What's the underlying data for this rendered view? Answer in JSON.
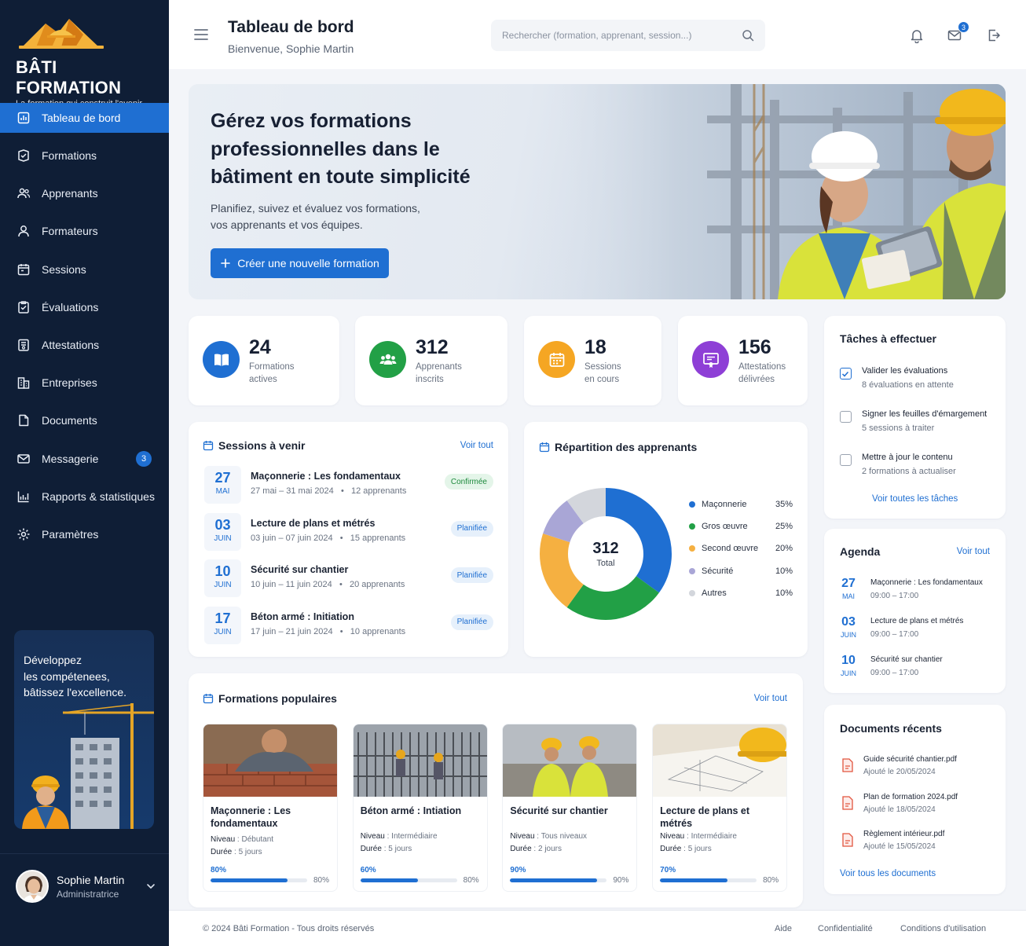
{
  "brand": {
    "name": "BÂTI FORMATION",
    "tagline": "La formation qui construit l'avenir"
  },
  "nav": [
    {
      "label": "Tableau de bord",
      "icon": "dashboard-icon",
      "active": true
    },
    {
      "label": "Formations",
      "icon": "book-check-icon"
    },
    {
      "label": "Apprenants",
      "icon": "users-icon"
    },
    {
      "label": "Formateurs",
      "icon": "user-icon"
    },
    {
      "label": "Sessions",
      "icon": "calendar-icon"
    },
    {
      "label": "Évaluations",
      "icon": "clipboard-check-icon"
    },
    {
      "label": "Attestations",
      "icon": "certificate-icon"
    },
    {
      "label": "Entreprises",
      "icon": "building-icon"
    },
    {
      "label": "Documents",
      "icon": "file-icon"
    },
    {
      "label": "Messagerie",
      "icon": "mail-icon",
      "badge": "3"
    },
    {
      "label": "Rapports & statistiques",
      "icon": "chart-icon"
    },
    {
      "label": "Paramètres",
      "icon": "gear-icon"
    }
  ],
  "promo": {
    "line1": "Développez",
    "line2": "les compétenees,",
    "line3": "bâtissez l'excellence."
  },
  "user": {
    "name": "Sophie Martin",
    "role": "Administratrice"
  },
  "header": {
    "title": "Tableau de bord",
    "subtitle": "Bienvenue, Sophie Martin",
    "search_placeholder": "Rechercher (formation, apprenant, session...)",
    "mail_badge": "3"
  },
  "hero": {
    "title": "Gérez vos formations professionnelles dans le bâtiment en toute simplicité",
    "desc_line1": "Planifiez, suivez et évaluez vos formations,",
    "desc_line2": "vos apprenants et vos équipes.",
    "button": "Créer une nouvelle formation"
  },
  "stats": [
    {
      "value": "24",
      "l1": "Formations",
      "l2": "actives",
      "color": "#1f6fd2"
    },
    {
      "value": "312",
      "l1": "Apprenants",
      "l2": "inscrits",
      "color": "#22a046"
    },
    {
      "value": "18",
      "l1": "Sessions",
      "l2": "en cours",
      "color": "#f5a623"
    },
    {
      "value": "156",
      "l1": "Attestations",
      "l2": "délivrées",
      "color": "#8e3fd6"
    }
  ],
  "sessions": {
    "title": "Sessions à venir",
    "link": "Voir tout",
    "items": [
      {
        "day": "27",
        "month": "MAI",
        "name": "Maçonnerie : Les fondamentaux",
        "dates": "27 mai – 31 mai 2024",
        "count": "12 apprenants",
        "status": "Confirmée",
        "status_color": "#1e8a3d",
        "status_bg": "#e4f5e9"
      },
      {
        "day": "03",
        "month": "JUIN",
        "name": "Lecture de plans et métrés",
        "dates": "03 juin – 07 juin 2024",
        "count": "15 apprenants",
        "status": "Planifiée",
        "status_color": "#1f6fd2",
        "status_bg": "#e6f0fb"
      },
      {
        "day": "10",
        "month": "JUIN",
        "name": "Sécurité sur chantier",
        "dates": "10 juin – 11 juin 2024",
        "count": "20 apprenants",
        "status": "Planifiée",
        "status_color": "#1f6fd2",
        "status_bg": "#e6f0fb"
      },
      {
        "day": "17",
        "month": "JUIN",
        "name": "Béton armé : Initiation",
        "dates": "17 juin – 21 juin 2024",
        "count": "10 apprenants",
        "status": "Planifiée",
        "status_color": "#1f6fd2",
        "status_bg": "#e6f0fb"
      }
    ]
  },
  "repartition": {
    "title": "Répartition des apprenants",
    "total": "312",
    "total_label": "Total"
  },
  "chart_data": {
    "type": "pie",
    "title": "Répartition des apprenants",
    "categories": [
      "Maçonnerie",
      "Gros œuvre",
      "Second œuvre",
      "Sécurité",
      "Autres"
    ],
    "values": [
      35,
      25,
      20,
      10,
      10
    ],
    "labels": [
      "35%",
      "25%",
      "20%",
      "10%",
      "10%"
    ],
    "colors": [
      "#1f6fd2",
      "#22a046",
      "#f5b041",
      "#a9a6d6",
      "#d3d6dc"
    ],
    "legend": "right"
  },
  "tasks": {
    "title": "Tâches à effectuer",
    "items": [
      {
        "title": "Valider les évaluations",
        "sub": "8 évaluations en attente",
        "checked": true
      },
      {
        "title": "Signer les feuilles d'émargement",
        "sub": "5 sessions à traiter",
        "checked": false
      },
      {
        "title": "Mettre à jour le contenu",
        "sub": "2 formations à actualiser",
        "checked": false
      }
    ],
    "link": "Voir toutes les tâches"
  },
  "agenda": {
    "title": "Agenda",
    "link": "Voir tout",
    "items": [
      {
        "day": "27",
        "month": "MAI",
        "title": "Maçonnerie : Les fondamentaux",
        "time": "09:00 – 17:00"
      },
      {
        "day": "03",
        "month": "JUIN",
        "title": "Lecture de plans et métrés",
        "time": "09:00 – 17:00"
      },
      {
        "day": "10",
        "month": "JUIN",
        "title": "Sécurité sur chantier",
        "time": "09:00 – 17:00"
      }
    ]
  },
  "documents": {
    "title": "Documents récents",
    "items": [
      {
        "name": "Guide sécurité chantier.pdf",
        "date": "Ajouté le 20/05/2024"
      },
      {
        "name": "Plan de formation 2024.pdf",
        "date": "Ajouté le 18/05/2024"
      },
      {
        "name": "Règlement intérieur.pdf",
        "date": "Ajouté le 15/05/2024"
      }
    ],
    "link": "Voir tous les documents"
  },
  "popular": {
    "title": "Formations populaires",
    "link": "Voir tout",
    "level_label": "Niveau",
    "duration_label": "Durée",
    "items": [
      {
        "title": "Maçonnerie : Les fondamentaux",
        "level": "Débutant",
        "duration": "5 jours",
        "progress": 80,
        "pct_label": "80%",
        "pct_right": "80%"
      },
      {
        "title": "Béton armé : Intiation",
        "level": "Intermédiaire",
        "duration": "5 jours",
        "progress": 60,
        "pct_label": "60%",
        "pct_right": "80%"
      },
      {
        "title": "Sécurité sur chantier",
        "level": "Tous niveaux",
        "duration": "2 jours",
        "progress": 90,
        "pct_label": "90%",
        "pct_right": "90%"
      },
      {
        "title": "Lecture de plans et métrés",
        "level": "Intermédiaire",
        "duration": "5 jours",
        "progress": 70,
        "pct_label": "70%",
        "pct_right": "80%"
      }
    ]
  },
  "footer": {
    "copyright": "© 2024 Bâti Formation - Tous droits réservés",
    "help": "Aide",
    "privacy": "Confidentialité",
    "terms": "Conditions d'utilisation"
  }
}
